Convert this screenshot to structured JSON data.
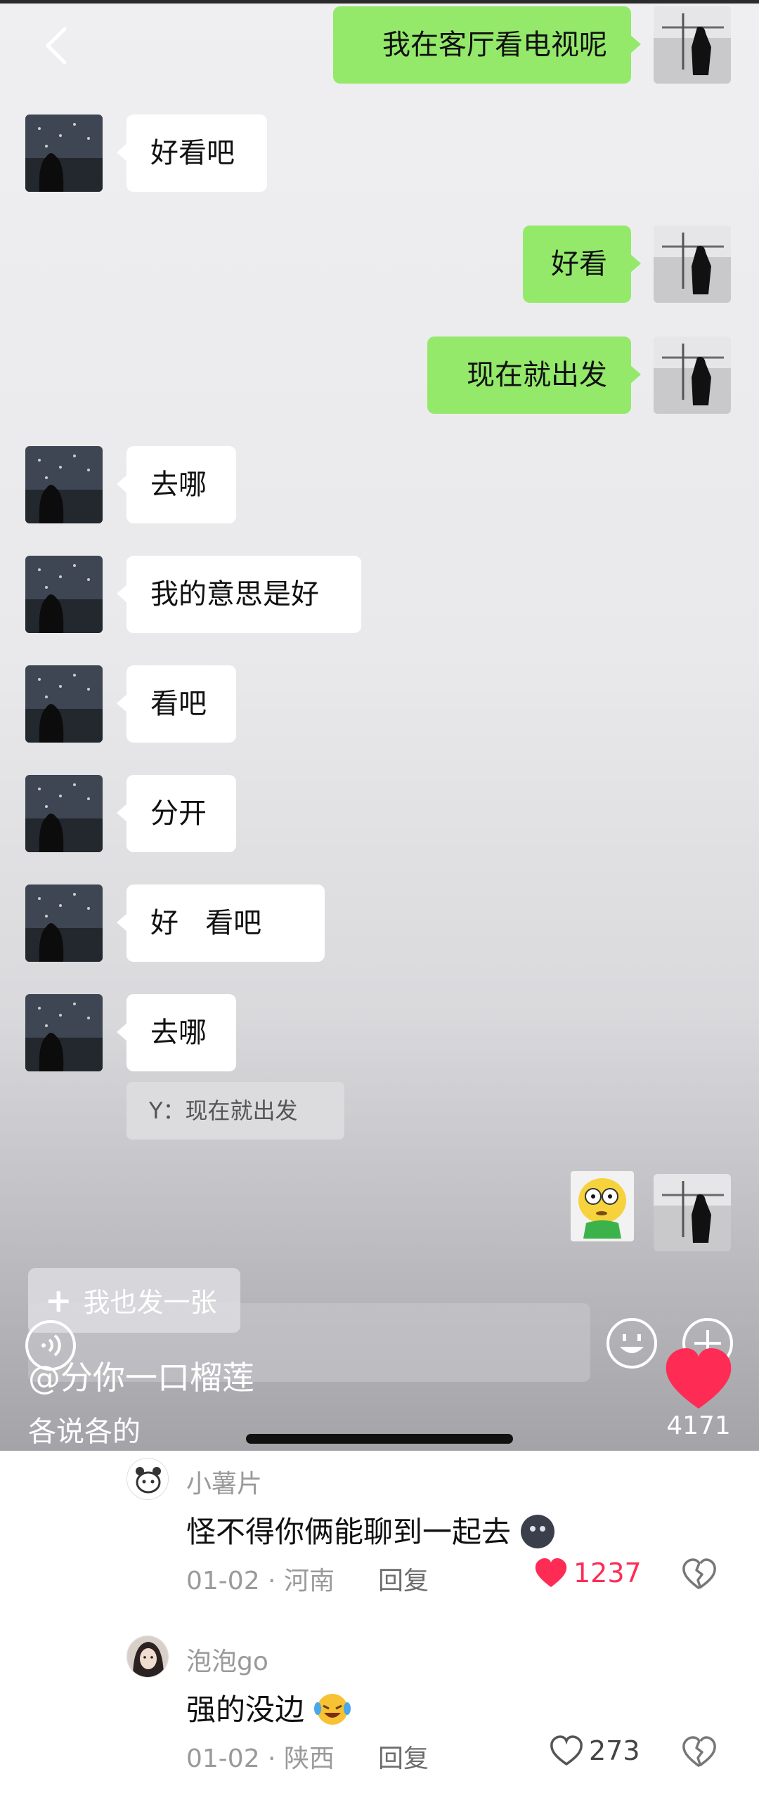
{
  "messages": [
    {
      "side": "right",
      "text": "我在客厅看电视呢"
    },
    {
      "side": "left",
      "text": "好看吧"
    },
    {
      "side": "right",
      "text": "好看"
    },
    {
      "side": "right",
      "text": "现在就出发"
    },
    {
      "side": "left",
      "text": "去哪"
    },
    {
      "side": "left",
      "text": "我的意思是好"
    },
    {
      "side": "left",
      "text": "看吧"
    },
    {
      "side": "left",
      "text": "分开"
    },
    {
      "side": "left",
      "text": "好   看吧"
    },
    {
      "side": "left",
      "text": "去哪"
    }
  ],
  "quote": "Y：现在就出发",
  "post": {
    "post_button": "我也发一张",
    "author": "@分你一口榴莲",
    "caption": "各说各的",
    "like_count": "4171",
    "like_color": "#fe2c55"
  },
  "comments": [
    {
      "username": "小薯片",
      "text": "怪不得你俩能聊到一起去",
      "date": "01-02",
      "location": "河南",
      "reply": "回复",
      "likes": "1237",
      "liked": true
    },
    {
      "username": "泡泡go",
      "text": "强的没边",
      "date": "01-02",
      "location": "陕西",
      "reply": "回复",
      "likes": "273",
      "liked": false
    }
  ],
  "colors": {
    "bubble_sent": "#94e96b",
    "bubble_received": "#ffffff",
    "liked_heart": "#fe2c55"
  }
}
